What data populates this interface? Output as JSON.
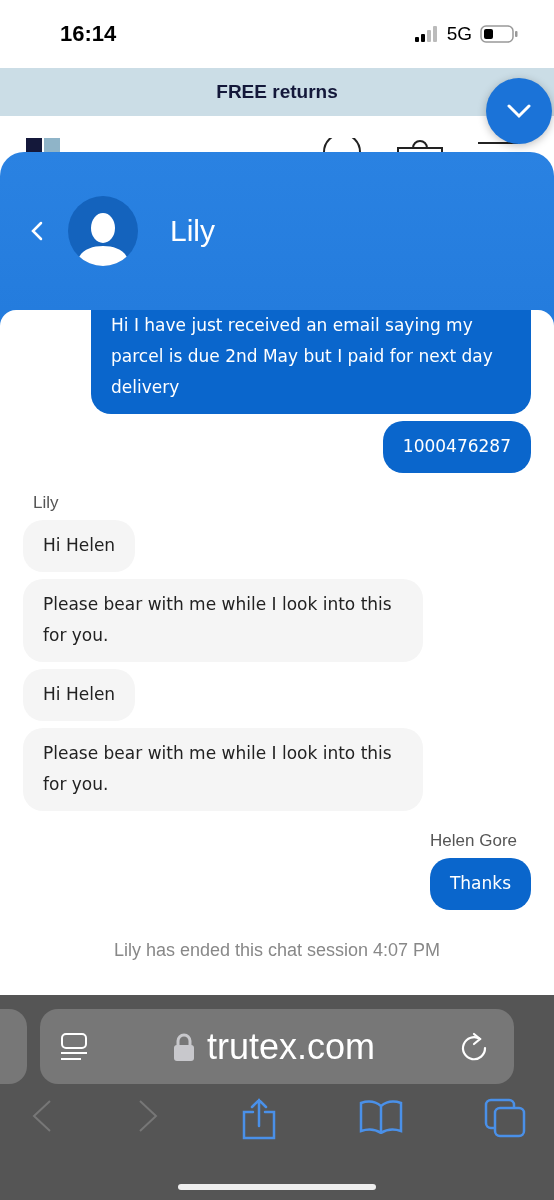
{
  "status_bar": {
    "time": "16:14",
    "network": "5G"
  },
  "banner": {
    "text": "FREE returns"
  },
  "chat": {
    "agent_name": "Lily",
    "messages": [
      {
        "kind": "sent",
        "text": "Hi I have just received an email saying my parcel is due 2nd May but I paid for next day delivery"
      },
      {
        "kind": "sent",
        "text": "1000476287"
      },
      {
        "kind": "sender_left",
        "text": "Lily"
      },
      {
        "kind": "received",
        "text": "Hi Helen"
      },
      {
        "kind": "received",
        "text": "Please bear with me while I look into this for you."
      },
      {
        "kind": "received",
        "text": "Hi Helen"
      },
      {
        "kind": "received",
        "text": "Please bear with me while I look into this for you."
      },
      {
        "kind": "sender_right",
        "text": "Helen Gore"
      },
      {
        "kind": "sent",
        "text": "Thanks"
      },
      {
        "kind": "system",
        "text": "Lily has ended this chat session 4:07 PM"
      }
    ]
  },
  "browser": {
    "url": "trutex.com"
  }
}
